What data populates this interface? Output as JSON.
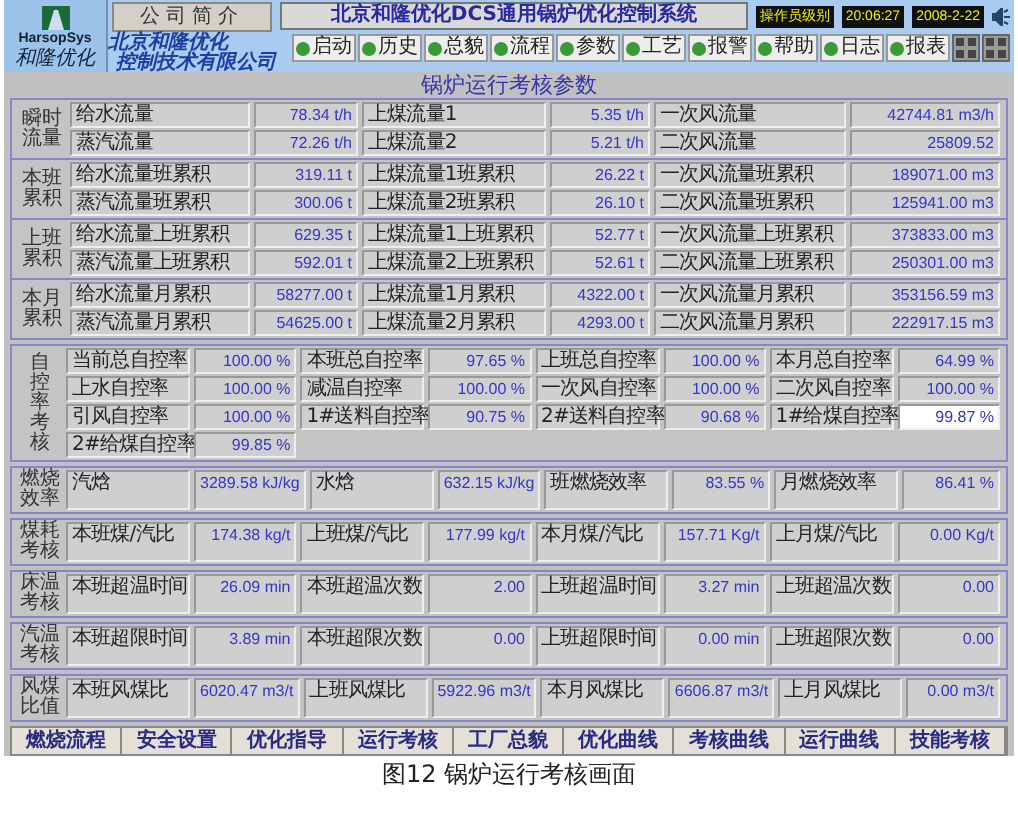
{
  "header": {
    "logo_latin": "HarsopSys",
    "logo_cn": "和隆优化",
    "about_button": "公司简介",
    "company": [
      "北京和隆优化",
      "控制技术有限公司"
    ],
    "system_title": "北京和隆优化DCS通用锅炉优化控制系统",
    "status": [
      "操作员级别",
      "20:06:27",
      "2008-2-22"
    ],
    "toolbar": [
      {
        "kind": "button",
        "label": "启动"
      },
      {
        "kind": "button",
        "label": "历史"
      },
      {
        "kind": "button",
        "label": "总貌"
      },
      {
        "kind": "button",
        "label": "流程"
      },
      {
        "kind": "button",
        "label": "参数"
      },
      {
        "kind": "button",
        "label": "工艺"
      },
      {
        "kind": "button",
        "label": "报警"
      },
      {
        "kind": "button",
        "label": "帮助"
      },
      {
        "kind": "button",
        "label": "日志"
      },
      {
        "kind": "button",
        "label": "报表"
      },
      {
        "kind": "icon"
      },
      {
        "kind": "icon"
      }
    ]
  },
  "page_title": "锅炉运行考核参数",
  "flow_groups": [
    {
      "head": "瞬时流量",
      "rows": [
        [
          {
            "label": "给水流量",
            "value": "78.34 t/h"
          },
          {
            "label": "上煤流量1",
            "value": "5.35 t/h"
          },
          {
            "label": "一次风流量",
            "value": "42744.81 m3/h"
          }
        ],
        [
          {
            "label": "蒸汽流量",
            "value": "72.26 t/h"
          },
          {
            "label": "上煤流量2",
            "value": "5.21 t/h"
          },
          {
            "label": "二次风流量",
            "value": "25809.52"
          }
        ]
      ]
    },
    {
      "head": "本班累积",
      "rows": [
        [
          {
            "label": "给水流量班累积",
            "value": "319.11 t"
          },
          {
            "label": "上煤流量1班累积",
            "value": "26.22 t"
          },
          {
            "label": "一次风流量班累积",
            "value": "189071.00 m3"
          }
        ],
        [
          {
            "label": "蒸汽流量班累积",
            "value": "300.06 t"
          },
          {
            "label": "上煤流量2班累积",
            "value": "26.10 t"
          },
          {
            "label": "二次风流量班累积",
            "value": "125941.00 m3"
          }
        ]
      ]
    },
    {
      "head": "上班累积",
      "rows": [
        [
          {
            "label": "给水流量上班累积",
            "value": "629.35 t"
          },
          {
            "label": "上煤流量1上班累积",
            "value": "52.77 t"
          },
          {
            "label": "一次风流量上班累积",
            "value": "373833.00 m3"
          }
        ],
        [
          {
            "label": "蒸汽流量上班累积",
            "value": "592.01 t"
          },
          {
            "label": "上煤流量2上班累积",
            "value": "52.61 t"
          },
          {
            "label": "二次风流量上班累积",
            "value": "250301.00 m3"
          }
        ]
      ]
    },
    {
      "head": "本月累积",
      "rows": [
        [
          {
            "label": "给水流量月累积",
            "value": "58277.00 t"
          },
          {
            "label": "上煤流量1月累积",
            "value": "4322.00 t"
          },
          {
            "label": "一次风流量月累积",
            "value": "353156.59 m3"
          }
        ],
        [
          {
            "label": "蒸汽流量月累积",
            "value": "54625.00 t"
          },
          {
            "label": "上煤流量2月累积",
            "value": "4293.00 t"
          },
          {
            "label": "二次风流量月累积",
            "value": "222917.15 m3"
          }
        ]
      ]
    }
  ],
  "sections": [
    {
      "head": "自控率考核",
      "kind": "vertical",
      "items": [
        {
          "label": "当前总自控率",
          "value": "100.00 %",
          "highlighted": false
        },
        {
          "label": "本班总自控率",
          "value": "97.65 %",
          "highlighted": false
        },
        {
          "label": "上班总自控率",
          "value": "100.00 %",
          "highlighted": false
        },
        {
          "label": "本月总自控率",
          "value": "64.99 %",
          "highlighted": false
        },
        {
          "label": "上水自控率",
          "value": "100.00 %",
          "highlighted": false
        },
        {
          "label": "减温自控率",
          "value": "100.00 %",
          "highlighted": false
        },
        {
          "label": "一次风自控率",
          "value": "100.00 %",
          "highlighted": false
        },
        {
          "label": "二次风自控率",
          "value": "100.00 %",
          "highlighted": false
        },
        {
          "label": "引风自控率",
          "value": "100.00 %",
          "highlighted": false
        },
        {
          "label": "1#送料自控率",
          "value": "90.75 %",
          "highlighted": false
        },
        {
          "label": "2#送料自控率",
          "value": "90.68 %",
          "highlighted": false
        },
        {
          "label": "1#给煤自控率",
          "value": "99.87 %",
          "highlighted": true
        },
        {
          "label": "2#给煤自控率",
          "value": "99.85 %",
          "highlighted": false
        }
      ]
    },
    {
      "head": "燃烧效率",
      "kind": "stacked",
      "items": [
        {
          "label": "汽焓",
          "value": "3289.58 kJ/kg"
        },
        {
          "label": "水焓",
          "value": "632.15 kJ/kg"
        },
        {
          "label": "班燃烧效率",
          "value": "83.55 %"
        },
        {
          "label": "月燃烧效率",
          "value": "86.41 %"
        }
      ]
    },
    {
      "head": "煤耗考核",
      "kind": "stacked",
      "items": [
        {
          "label": "本班煤/汽比",
          "value": "174.38 kg/t"
        },
        {
          "label": "上班煤/汽比",
          "value": "177.99 kg/t"
        },
        {
          "label": "本月煤/汽比",
          "value": "157.71 Kg/t"
        },
        {
          "label": "上月煤/汽比",
          "value": "0.00 Kg/t"
        }
      ]
    },
    {
      "head": "床温考核",
      "kind": "stacked",
      "items": [
        {
          "label": "本班超温时间",
          "value": "26.09 min"
        },
        {
          "label": "本班超温次数",
          "value": "2.00"
        },
        {
          "label": "上班超温时间",
          "value": "3.27 min"
        },
        {
          "label": "上班超温次数",
          "value": "0.00"
        }
      ]
    },
    {
      "head": "汽温考核",
      "kind": "stacked",
      "items": [
        {
          "label": "本班超限时间",
          "value": "3.89 min"
        },
        {
          "label": "本班超限次数",
          "value": "0.00"
        },
        {
          "label": "上班超限时间",
          "value": "0.00 min"
        },
        {
          "label": "上班超限次数",
          "value": "0.00"
        }
      ]
    },
    {
      "head": "风煤比值",
      "kind": "stacked",
      "items": [
        {
          "label": "本班风煤比",
          "value": "6020.47 m3/t"
        },
        {
          "label": "上班风煤比",
          "value": "5922.96 m3/t"
        },
        {
          "label": "本月风煤比",
          "value": "6606.87 m3/t"
        },
        {
          "label": "上月风煤比",
          "value": "0.00 m3/t"
        }
      ]
    }
  ],
  "tabs": [
    {
      "label": "燃烧流程"
    },
    {
      "label": "安全设置"
    },
    {
      "label": "优化指导"
    },
    {
      "label": "运行考核"
    },
    {
      "label": "工厂总貌"
    },
    {
      "label": "优化曲线"
    },
    {
      "label": "考核曲线"
    },
    {
      "label": "运行曲线"
    },
    {
      "label": "技能考核"
    }
  ],
  "caption": "图12 锅炉运行考核画面"
}
